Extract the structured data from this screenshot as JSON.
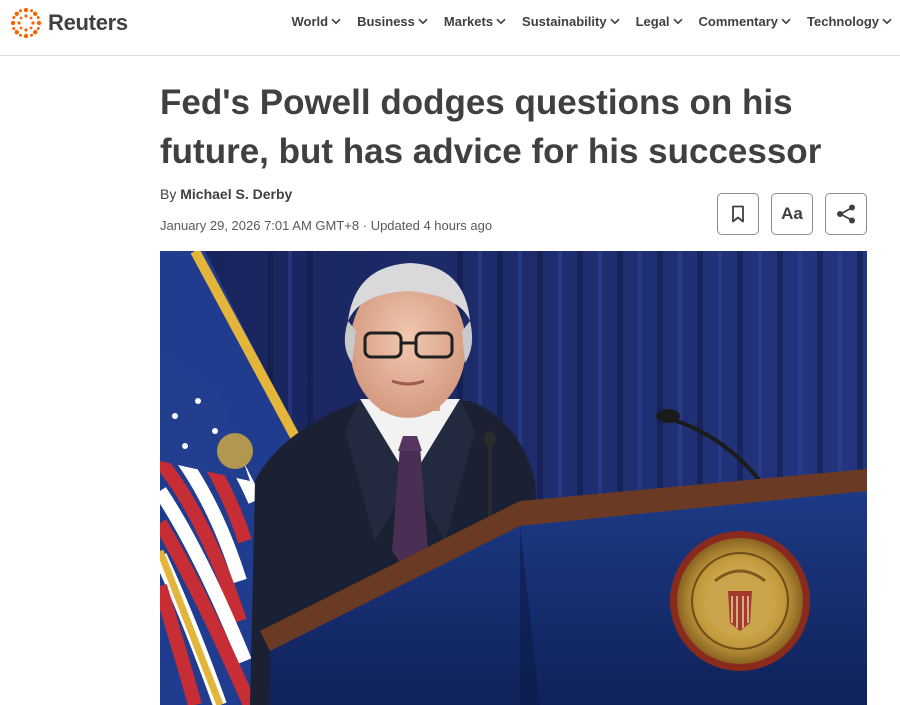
{
  "header": {
    "logo_text": "Reuters",
    "nav": [
      {
        "label": "World"
      },
      {
        "label": "Business"
      },
      {
        "label": "Markets"
      },
      {
        "label": "Sustainability"
      },
      {
        "label": "Legal"
      },
      {
        "label": "Commentary"
      },
      {
        "label": "Technology"
      }
    ]
  },
  "article": {
    "headline": "Fed's Powell dodges questions on his future, but has advice for his successor",
    "byline_prefix": "By",
    "author": "Michael S. Derby",
    "date": "January 29, 2026 7:01 AM GMT+8",
    "separator": "·",
    "updated": "Updated 4 hours ago"
  },
  "tools": {
    "bookmark_icon": "bookmark-icon",
    "text_size_label": "Aa",
    "share_icon": "share-icon"
  },
  "photo": {
    "subject": "man-at-podium-with-federal-reserve-seal"
  },
  "colors": {
    "accent_orange": "#fa6400",
    "text": "#404040",
    "curtain_blue": "#1b2a66"
  }
}
